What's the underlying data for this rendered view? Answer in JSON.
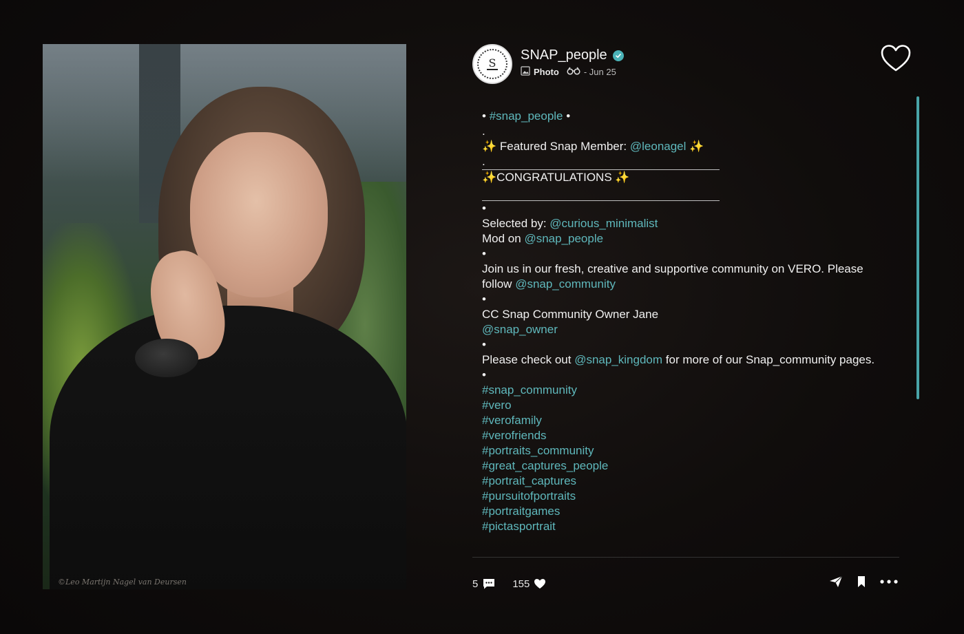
{
  "post": {
    "photo_watermark": "©Leo Martijn Nagel van Deursen",
    "author": {
      "avatar_text": "S",
      "name": "SNAP_people"
    },
    "meta": {
      "type_label": "Photo",
      "date": "- Jun 25"
    },
    "caption": [
      {
        "parts": [
          {
            "t": "• "
          },
          {
            "t": "#snap_people",
            "link": true
          },
          {
            "t": " •"
          }
        ]
      },
      {
        "parts": [
          {
            "t": "."
          }
        ]
      },
      {
        "parts": [
          {
            "t": "✨ Featured Snap Member: "
          },
          {
            "t": "@leonagel",
            "link": true
          },
          {
            "t": " ✨"
          }
        ]
      },
      {
        "parts": [
          {
            "t": "."
          }
        ]
      },
      {
        "rule": true
      },
      {
        "parts": [
          {
            "t": "✨CONGRATULATIONS ✨"
          }
        ]
      },
      {
        "spacer": true
      },
      {
        "rule": true
      },
      {
        "parts": [
          {
            "t": "•"
          }
        ]
      },
      {
        "parts": [
          {
            "t": "Selected by: "
          },
          {
            "t": "@curious_minimalist",
            "link": true
          }
        ]
      },
      {
        "parts": [
          {
            "t": "Mod on "
          },
          {
            "t": "@snap_people",
            "link": true
          }
        ]
      },
      {
        "parts": [
          {
            "t": "•"
          }
        ]
      },
      {
        "parts": [
          {
            "t": "Join us in our fresh, creative and supportive community on VERO. Please follow "
          },
          {
            "t": "@snap_community",
            "link": true
          }
        ]
      },
      {
        "parts": [
          {
            "t": "•"
          }
        ]
      },
      {
        "parts": [
          {
            "t": "CC Snap Community Owner Jane"
          }
        ]
      },
      {
        "parts": [
          {
            "t": "@snap_owner",
            "link": true
          }
        ]
      },
      {
        "parts": [
          {
            "t": "•"
          }
        ]
      },
      {
        "parts": [
          {
            "t": "Please check out "
          },
          {
            "t": "@snap_kingdom",
            "link": true
          },
          {
            "t": " for more of our Snap_community pages."
          }
        ]
      },
      {
        "parts": [
          {
            "t": "•"
          }
        ]
      },
      {
        "parts": [
          {
            "t": "#snap_community",
            "link": true
          }
        ]
      },
      {
        "parts": [
          {
            "t": "#vero",
            "link": true
          }
        ]
      },
      {
        "parts": [
          {
            "t": "#verofamily",
            "link": true
          }
        ]
      },
      {
        "parts": [
          {
            "t": "#verofriends",
            "link": true
          }
        ]
      },
      {
        "parts": [
          {
            "t": "#portraits_community",
            "link": true
          }
        ]
      },
      {
        "parts": [
          {
            "t": "#great_captures_people",
            "link": true
          }
        ]
      },
      {
        "parts": [
          {
            "t": "#portrait_captures",
            "link": true
          }
        ]
      },
      {
        "parts": [
          {
            "t": "#pursuitofportraits",
            "link": true
          }
        ]
      },
      {
        "parts": [
          {
            "t": "#portraitgames",
            "link": true
          }
        ]
      },
      {
        "parts": [
          {
            "t": "#pictasportrait",
            "link": true
          }
        ]
      }
    ],
    "stats": {
      "comments": "5",
      "likes": "155"
    }
  },
  "colors": {
    "link": "#5fb8bc",
    "verified": "#4ab2b7",
    "scrollbar": "#49a4a8"
  },
  "icons": [
    "heart-outline-icon",
    "verified-icon",
    "photo-icon",
    "binoculars-icon",
    "comment-icon",
    "heart-icon",
    "send-icon",
    "bookmark-icon",
    "more-icon"
  ]
}
